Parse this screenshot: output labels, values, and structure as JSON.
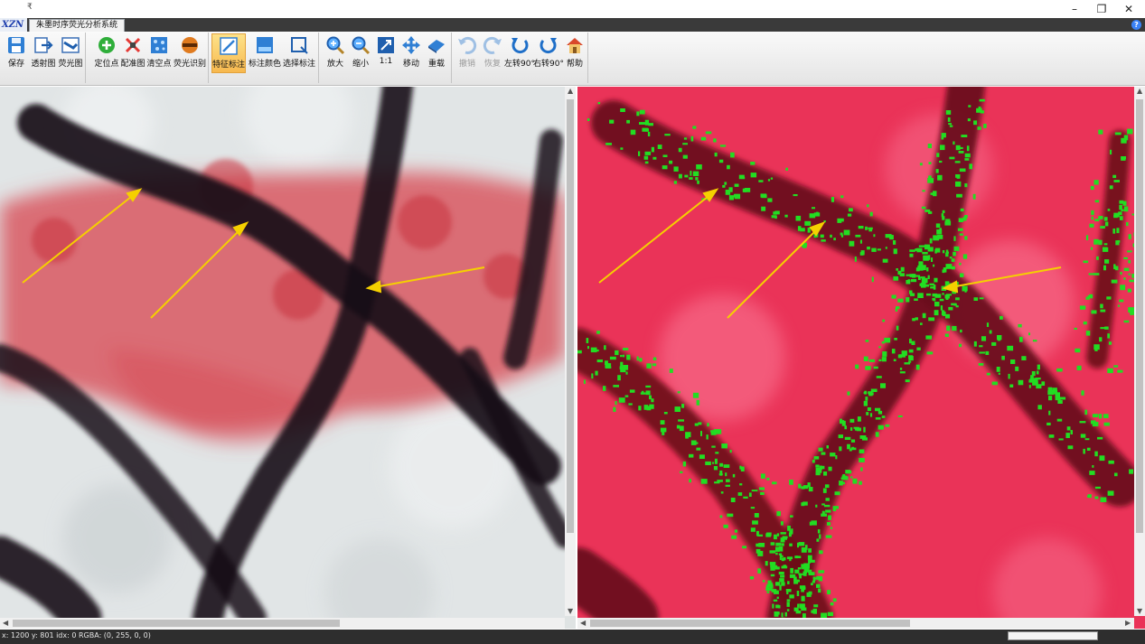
{
  "window": {
    "qat_symbol": "₹",
    "minimize": "–",
    "restore": "❐",
    "close": "✕"
  },
  "logo_text": "XZN",
  "tab": {
    "label": "朱墨时序荧光分析系统"
  },
  "help": "?",
  "ribbon": {
    "groups": [
      {
        "buttons": [
          {
            "label": "保存",
            "icon": "save-icon"
          },
          {
            "label": "透射图",
            "icon": "transmission-image-icon"
          },
          {
            "label": "荧光图",
            "icon": "fluorescence-image-icon"
          }
        ]
      },
      {
        "buttons": [
          {
            "label": "定位点",
            "icon": "locate-point-icon"
          },
          {
            "label": "配准图",
            "icon": "registration-icon"
          },
          {
            "label": "清空点",
            "icon": "clear-points-icon"
          },
          {
            "label": "荧光识别",
            "icon": "fluorescence-recognition-icon"
          }
        ]
      },
      {
        "buttons": [
          {
            "label": "特征标注",
            "icon": "feature-annotation-icon",
            "active": true
          },
          {
            "label": "标注颜色",
            "icon": "annotation-color-icon"
          },
          {
            "label": "选择标注",
            "icon": "select-annotation-icon"
          }
        ]
      },
      {
        "buttons": [
          {
            "label": "放大",
            "icon": "zoom-in-icon"
          },
          {
            "label": "缩小",
            "icon": "zoom-out-icon"
          },
          {
            "label": "1:1",
            "icon": "actual-size-icon"
          },
          {
            "label": "移动",
            "icon": "move-icon"
          },
          {
            "label": "重载",
            "icon": "reload-icon"
          }
        ]
      },
      {
        "buttons": [
          {
            "label": "撤销",
            "icon": "undo-icon",
            "disabled": true
          },
          {
            "label": "恢复",
            "icon": "redo-icon",
            "disabled": true
          },
          {
            "label": "左转90°",
            "icon": "rotate-left-icon"
          },
          {
            "label": "右转90°",
            "icon": "rotate-right-icon"
          },
          {
            "label": "帮助",
            "icon": "help-home-icon"
          }
        ]
      }
    ]
  },
  "status": {
    "text": "x: 1200 y: 801  idx: 0  RGBA: (0, 255, 0, 0)"
  },
  "colors": {
    "annotation_arrow": "#f5d000",
    "fluorescence_mark": "#22dd22",
    "fluorescence_background": "#ea3358",
    "active_button": "#f7b94f"
  }
}
